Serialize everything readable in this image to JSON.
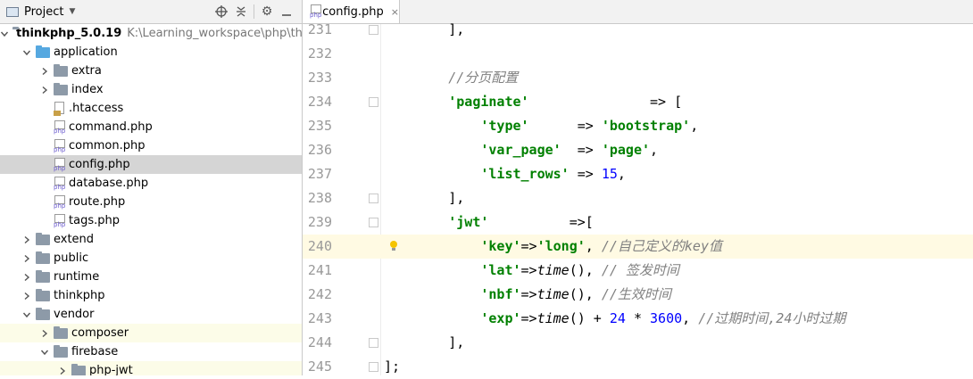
{
  "project": {
    "title": "Project",
    "tree": [
      {
        "label": "thinkphp_5.0.19",
        "path": "K:\\Learning_workspace\\php\\thinkp",
        "kind": "root",
        "depth": 0,
        "expanded": true
      },
      {
        "label": "application",
        "kind": "folder-blue",
        "depth": 1,
        "expanded": true
      },
      {
        "label": "extra",
        "kind": "folder",
        "depth": 2,
        "expanded": false
      },
      {
        "label": "index",
        "kind": "folder",
        "depth": 2,
        "expanded": false
      },
      {
        "label": ".htaccess",
        "kind": "htaccess",
        "depth": 2
      },
      {
        "label": "command.php",
        "kind": "php",
        "depth": 2
      },
      {
        "label": "common.php",
        "kind": "php",
        "depth": 2
      },
      {
        "label": "config.php",
        "kind": "php",
        "depth": 2,
        "selected": true
      },
      {
        "label": "database.php",
        "kind": "php",
        "depth": 2
      },
      {
        "label": "route.php",
        "kind": "php",
        "depth": 2
      },
      {
        "label": "tags.php",
        "kind": "php",
        "depth": 2
      },
      {
        "label": "extend",
        "kind": "folder",
        "depth": 1,
        "expanded": false
      },
      {
        "label": "public",
        "kind": "folder",
        "depth": 1,
        "expanded": false
      },
      {
        "label": "runtime",
        "kind": "folder",
        "depth": 1,
        "expanded": false
      },
      {
        "label": "thinkphp",
        "kind": "folder",
        "depth": 1,
        "expanded": false
      },
      {
        "label": "vendor",
        "kind": "folder",
        "depth": 1,
        "expanded": true
      },
      {
        "label": "composer",
        "kind": "folder",
        "depth": 2,
        "expanded": false,
        "hl": true
      },
      {
        "label": "firebase",
        "kind": "folder",
        "depth": 2,
        "expanded": true
      },
      {
        "label": "php-jwt",
        "kind": "folder",
        "depth": 3,
        "expanded": false,
        "hl": true
      }
    ]
  },
  "editor": {
    "tab": {
      "label": "config.php",
      "close": "×"
    },
    "php_badge": "php",
    "lines": [
      {
        "n": "231",
        "tokens": [
          [
            "p",
            "        ],"
          ]
        ],
        "fold": true
      },
      {
        "n": "232",
        "tokens": []
      },
      {
        "n": "233",
        "tokens": [
          [
            "c",
            "        //分页配置"
          ]
        ]
      },
      {
        "n": "234",
        "tokens": [
          [
            "p",
            "        "
          ],
          [
            "k",
            "'paginate'"
          ],
          [
            "p",
            "               => ["
          ]
        ],
        "fold": true
      },
      {
        "n": "235",
        "tokens": [
          [
            "p",
            "            "
          ],
          [
            "k",
            "'type'"
          ],
          [
            "p",
            "      => "
          ],
          [
            "k",
            "'bootstrap'"
          ],
          [
            "p",
            ","
          ]
        ]
      },
      {
        "n": "236",
        "tokens": [
          [
            "p",
            "            "
          ],
          [
            "k",
            "'var_page'"
          ],
          [
            "p",
            "  => "
          ],
          [
            "k",
            "'page'"
          ],
          [
            "p",
            ","
          ]
        ]
      },
      {
        "n": "237",
        "tokens": [
          [
            "p",
            "            "
          ],
          [
            "k",
            "'list_rows'"
          ],
          [
            "p",
            " => "
          ],
          [
            "n",
            "15"
          ],
          [
            "p",
            ","
          ]
        ]
      },
      {
        "n": "238",
        "tokens": [
          [
            "p",
            "        ],"
          ]
        ],
        "fold": true
      },
      {
        "n": "239",
        "tokens": [
          [
            "p",
            "        "
          ],
          [
            "k",
            "'jwt'"
          ],
          [
            "p",
            "          =>["
          ]
        ],
        "fold": true
      },
      {
        "n": "240",
        "tokens": [
          [
            "p",
            "            "
          ],
          [
            "k",
            "'key'"
          ],
          [
            "p",
            "=>"
          ],
          [
            "k",
            "'long'"
          ],
          [
            "p",
            ", "
          ],
          [
            "c",
            "//自己定义的key值"
          ]
        ],
        "current": true,
        "bulb": true
      },
      {
        "n": "241",
        "tokens": [
          [
            "p",
            "            "
          ],
          [
            "k",
            "'lat'"
          ],
          [
            "p",
            "=>"
          ],
          [
            "f",
            "time"
          ],
          [
            "p",
            "(), "
          ],
          [
            "c",
            "// 签发时间"
          ]
        ]
      },
      {
        "n": "242",
        "tokens": [
          [
            "p",
            "            "
          ],
          [
            "k",
            "'nbf'"
          ],
          [
            "p",
            "=>"
          ],
          [
            "f",
            "time"
          ],
          [
            "p",
            "(), "
          ],
          [
            "c",
            "//生效时间"
          ]
        ]
      },
      {
        "n": "243",
        "tokens": [
          [
            "p",
            "            "
          ],
          [
            "k",
            "'exp'"
          ],
          [
            "p",
            "=>"
          ],
          [
            "f",
            "time"
          ],
          [
            "p",
            "() + "
          ],
          [
            "n",
            "24"
          ],
          [
            "p",
            " * "
          ],
          [
            "n",
            "3600"
          ],
          [
            "p",
            ", "
          ],
          [
            "c",
            "//过期时间,24小时过期"
          ]
        ]
      },
      {
        "n": "244",
        "tokens": [
          [
            "p",
            "        ],"
          ]
        ],
        "fold": true
      },
      {
        "n": "245",
        "tokens": [
          [
            "p",
            "];"
          ]
        ],
        "fold": true
      }
    ]
  }
}
